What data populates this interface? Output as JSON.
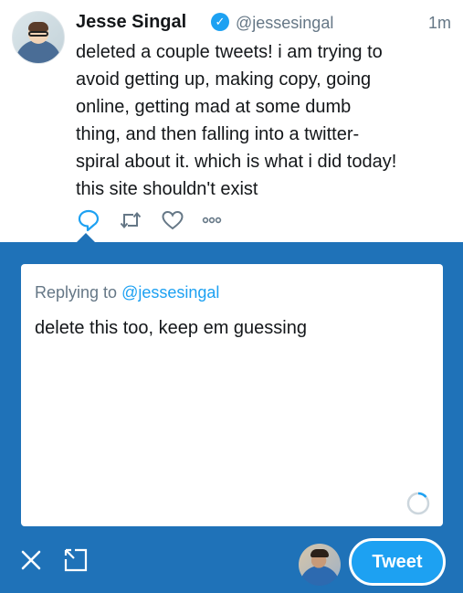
{
  "tweet": {
    "author_name": "Jesse Singal",
    "handle": "@jessesingal",
    "time": "1m",
    "text": "deleted a couple tweets! i am trying to\navoid getting up, making copy, going\nonline, getting mad at some dumb\nthing, and then falling into a twitter-\nspiral about it. which is what i did today!\nthis site shouldn't exist",
    "verified_glyph": "✓"
  },
  "icons": {
    "reply": "reply-icon",
    "retweet": "retweet-icon",
    "like": "heart-icon",
    "more": "more-icon",
    "verified": "verified-badge-icon",
    "close": "close-icon",
    "expand": "expand-icon",
    "counter": "character-counter-ring"
  },
  "composer": {
    "replying_prefix": "Replying to ",
    "replying_handle": "@jessesingal",
    "draft_text": "delete this too, keep em guessing",
    "submit_label": "Tweet"
  },
  "colors": {
    "brand_blue": "#1da1f2",
    "composer_bg": "#1f72b8",
    "text_primary": "#14171a",
    "text_secondary": "#657786"
  }
}
